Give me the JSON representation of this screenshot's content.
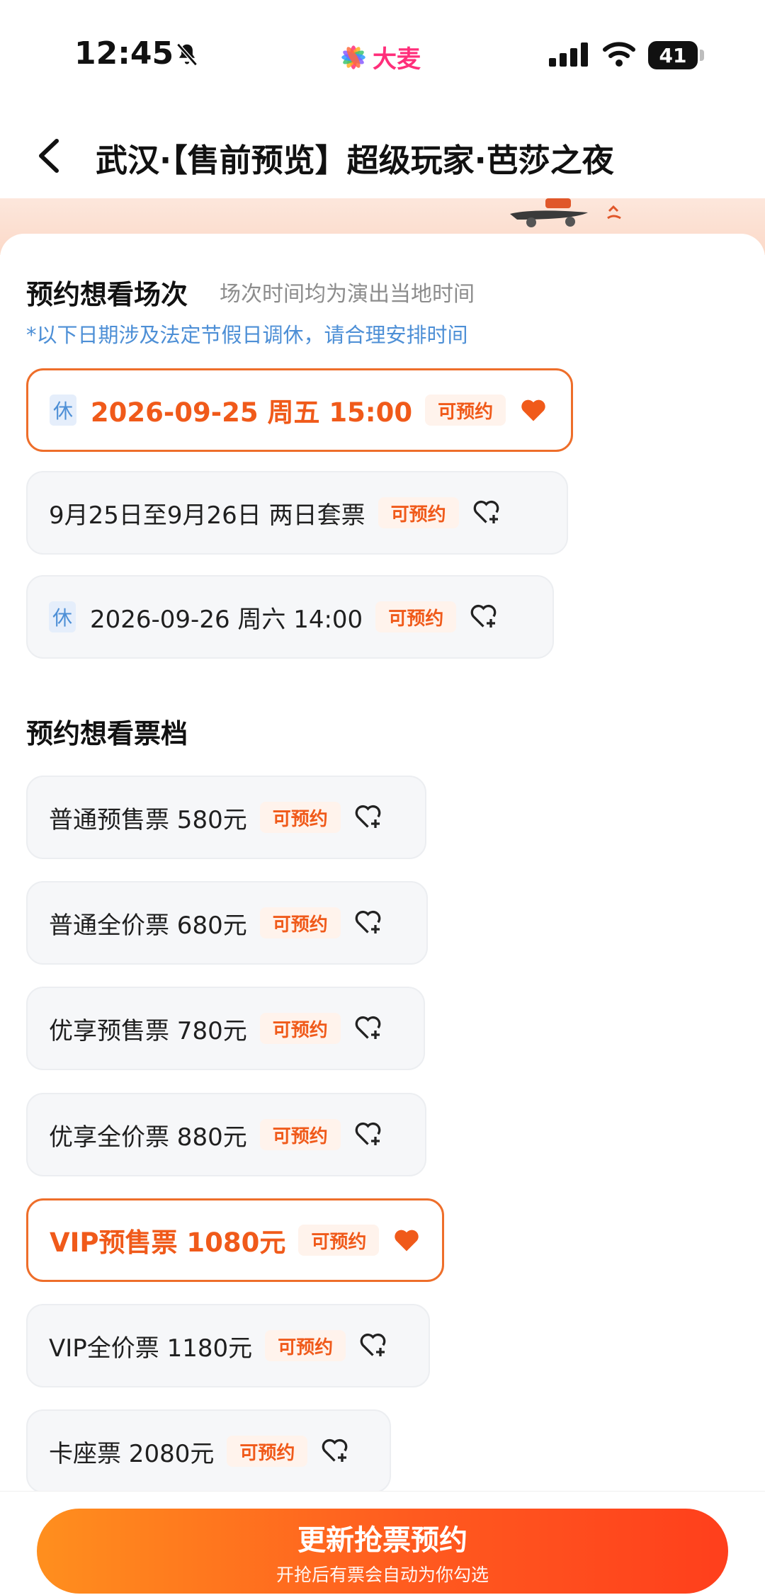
{
  "status_bar": {
    "time": "12:45",
    "battery": "41"
  },
  "brand": {
    "name": "大麦"
  },
  "header": {
    "title": "武汉·【售前预览】超级玩家·芭莎之夜"
  },
  "sessions_section": {
    "title": "预约想看场次",
    "note": "场次时间均为演出当地时间",
    "notice": "*以下日期涉及法定节假日调休，请合理安排时间",
    "items": [
      {
        "holiday_tag": "休",
        "label": "2026-09-25 周五 15:00",
        "badge": "可预约",
        "selected": true
      },
      {
        "holiday_tag": "",
        "label": "9月25日至9月26日 两日套票",
        "badge": "可预约",
        "selected": false
      },
      {
        "holiday_tag": "休",
        "label": "2026-09-26 周六 14:00",
        "badge": "可预约",
        "selected": false
      }
    ]
  },
  "tiers_section": {
    "title": "预约想看票档",
    "items": [
      {
        "label": "普通预售票 580元",
        "badge": "可预约",
        "selected": false
      },
      {
        "label": "普通全价票 680元",
        "badge": "可预约",
        "selected": false
      },
      {
        "label": "优享预售票 780元",
        "badge": "可预约",
        "selected": false
      },
      {
        "label": "优享全价票 880元",
        "badge": "可预约",
        "selected": false
      },
      {
        "label": "VIP预售票 1080元",
        "badge": "可预约",
        "selected": true
      },
      {
        "label": "VIP全价票 1180元",
        "badge": "可预约",
        "selected": false
      },
      {
        "label": "卡座票 2080元",
        "badge": "可预约",
        "selected": false
      }
    ]
  },
  "cta": {
    "main": "更新抢票预约",
    "sub": "开抢后有票会自动为你勾选"
  },
  "colors": {
    "accent": "#f05a1a",
    "notice_blue": "#4d8fd6",
    "brand_pink": "#ff2e7a"
  }
}
